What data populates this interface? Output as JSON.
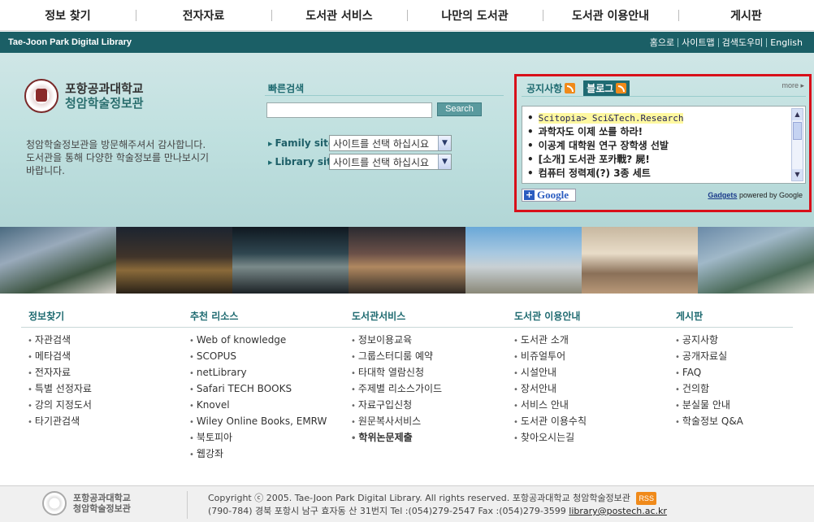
{
  "topnav": {
    "items": [
      "정보 찾기",
      "전자자료",
      "도서관 서비스",
      "나만의 도서관",
      "도서관 이용안내",
      "게시판"
    ]
  },
  "bar": {
    "brand": "Tae-Joon Park Digital Library",
    "links": [
      "홈으로",
      "사이트맵",
      "검색도우미",
      "English"
    ]
  },
  "logo": {
    "line1": "포항공과대학교",
    "line2": "청암학술정보관"
  },
  "welcome": {
    "lines": [
      "청암학술정보관을 방문해주셔서 감사합니다.",
      "도서관을 통해 다양한 학술정보를 만나보시기",
      "바랍니다."
    ]
  },
  "quick_search": {
    "title": "빠른검색",
    "value": "",
    "button": "Search"
  },
  "family_site": {
    "label": "Family site",
    "selected": "사이트를 선택 하십시요"
  },
  "library_site": {
    "label": "Library site",
    "selected": "사이트를 선택 하십시요"
  },
  "gadget": {
    "tabs": [
      "공지사항",
      "블로그"
    ],
    "active_tab": "블로그",
    "more": "more ▸",
    "items": [
      "Scitopia> Sci&Tech.Research",
      "과학자도 이제 쏘를 하라!",
      "이공계 대학원 연구 장학생 선발",
      "[소개] 도서관 포카戰? 屍!",
      "컴퓨터 정력제(?) 3종 세트"
    ],
    "add_button": "Google",
    "gadgets_link": "Gadgets",
    "powered_by": "powered by Google"
  },
  "columns": [
    {
      "title": "정보찾기",
      "links": [
        "자관검색",
        "메타검색",
        "전자자료",
        "특별 선정자료",
        "강의 지정도서",
        "타기관검색"
      ]
    },
    {
      "title": "추천 리소스",
      "links": [
        "Web of knowledge",
        "SCOPUS",
        "netLibrary",
        "Safari TECH BOOKS",
        "Knovel",
        "Wiley Online Books, EMRW",
        "북토피아",
        "웹강좌"
      ]
    },
    {
      "title": "도서관서비스",
      "links": [
        "정보이용교육",
        "그룹스터디룸 예약",
        "타대학 열람신청",
        "주제별 리소스가이드",
        "자료구입신청",
        "원문복사서비스",
        "학위논문제출"
      ]
    },
    {
      "title": "도서관 이용안내",
      "links": [
        "도서관 소개",
        "비쥬얼투어",
        "시설안내",
        "장서안내",
        "서비스 안내",
        "도서관 이용수칙",
        "찾아오시는길"
      ]
    },
    {
      "title": "게시판",
      "links": [
        "공지사항",
        "공개자료실",
        "FAQ",
        "건의함",
        "분실물 안내",
        "학술정보 Q&A"
      ]
    }
  ],
  "footer": {
    "logo_line1": "포항공과대학교",
    "logo_line2": "청암학술정보관",
    "copyright": "Copyright ⓒ 2005. Tae-Joon Park Digital Library. All rights reserved. 포항공과대학교 청암학술정보관",
    "rss": "RSS",
    "address": "(790-784) 경북 포항시 남구 효자동 산 31번지 Tel :(054)279-2547 Fax :(054)279-3599",
    "email": "library@postech.ac.kr"
  }
}
